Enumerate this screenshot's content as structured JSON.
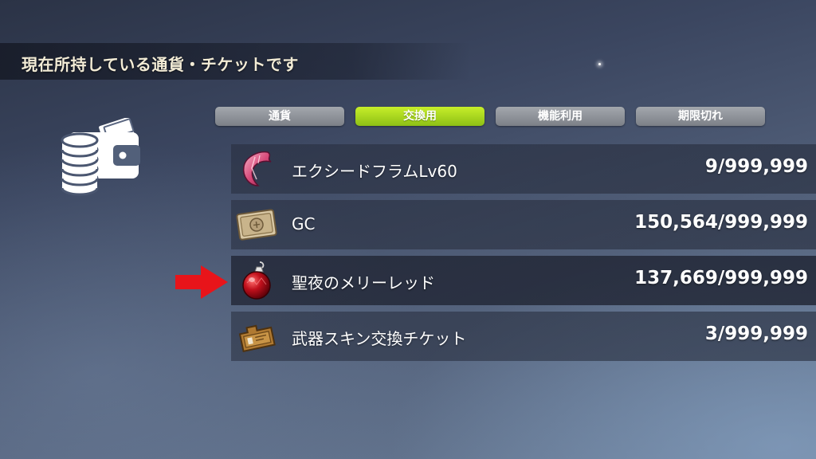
{
  "header": {
    "title": "現在所持している通貨・チケットです"
  },
  "wallet": {
    "icon": "wallet-coins-icon"
  },
  "tabs": [
    {
      "label": "通貨",
      "active": false
    },
    {
      "label": "交換用",
      "active": true
    },
    {
      "label": "機能利用",
      "active": false
    },
    {
      "label": "期限切れ",
      "active": false
    }
  ],
  "items": [
    {
      "name": "エクシードフラムLv60",
      "count": "9/999,999",
      "icon": "pink-crystal-shard-icon"
    },
    {
      "name": "GC",
      "count": "150,564/999,999",
      "icon": "gc-card-icon"
    },
    {
      "name": "聖夜のメリーレッド",
      "count": "137,669/999,999",
      "icon": "red-ornament-icon",
      "highlighted": true
    },
    {
      "name": "武器スキン交換チケット",
      "count": "3/999,999",
      "icon": "weapon-skin-ticket-icon"
    }
  ],
  "pointer": {
    "icon": "red-arrow-icon",
    "color": "#e8141a"
  },
  "colors": {
    "active_tab": "#a8d81e",
    "inactive_tab": "#8d9197",
    "title_text": "#f3ecd6"
  }
}
